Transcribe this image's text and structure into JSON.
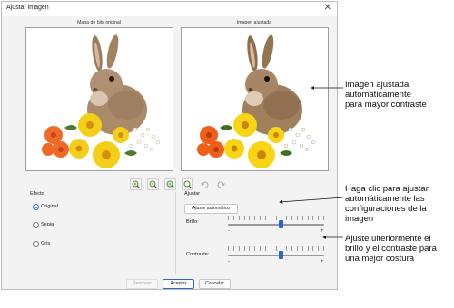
{
  "dialog": {
    "title": "Ajustar imagen",
    "close_glyph": "✕",
    "left_caption": "Mapa de bits original",
    "right_caption": "Imagen ajustada"
  },
  "toolbar": {
    "icons": [
      "zoom-in-icon",
      "zoom-out-icon",
      "zoom-region-icon",
      "zoom-fit-icon",
      "undo-icon",
      "redo-icon"
    ]
  },
  "efecto": {
    "label": "Efecto",
    "options": [
      {
        "label": "Original",
        "selected": true
      },
      {
        "label": "Sepia",
        "selected": false
      },
      {
        "label": "Gris",
        "selected": false
      }
    ]
  },
  "ajustar": {
    "label": "Ajustar",
    "auto_button": "Ajuste automático",
    "brillo_label": "Brillo:",
    "contraste_label": "Contraste:",
    "minus": "-",
    "plus": "+",
    "brillo_value": 0.55,
    "contraste_value": 0.55
  },
  "footer": {
    "remove": "Remover",
    "accept": "Aceptar",
    "cancel": "Cancelar"
  },
  "annotations": {
    "a1": [
      "Imagen ajustada",
      "automáticamente",
      "para mayor contraste"
    ],
    "a2": [
      "Haga clic para ajustar",
      "automáticamente las",
      "configuraciones de la",
      "imagen"
    ],
    "a3": [
      "Ajuste ulteriormente el",
      "brillo y el contraste para",
      "una mejor costura"
    ]
  },
  "colors": {
    "accent": "#2b67c6",
    "flower_yellow": "#f4cf1a",
    "flower_orange": "#ee6a26",
    "rabbit": "#a98a6a"
  }
}
